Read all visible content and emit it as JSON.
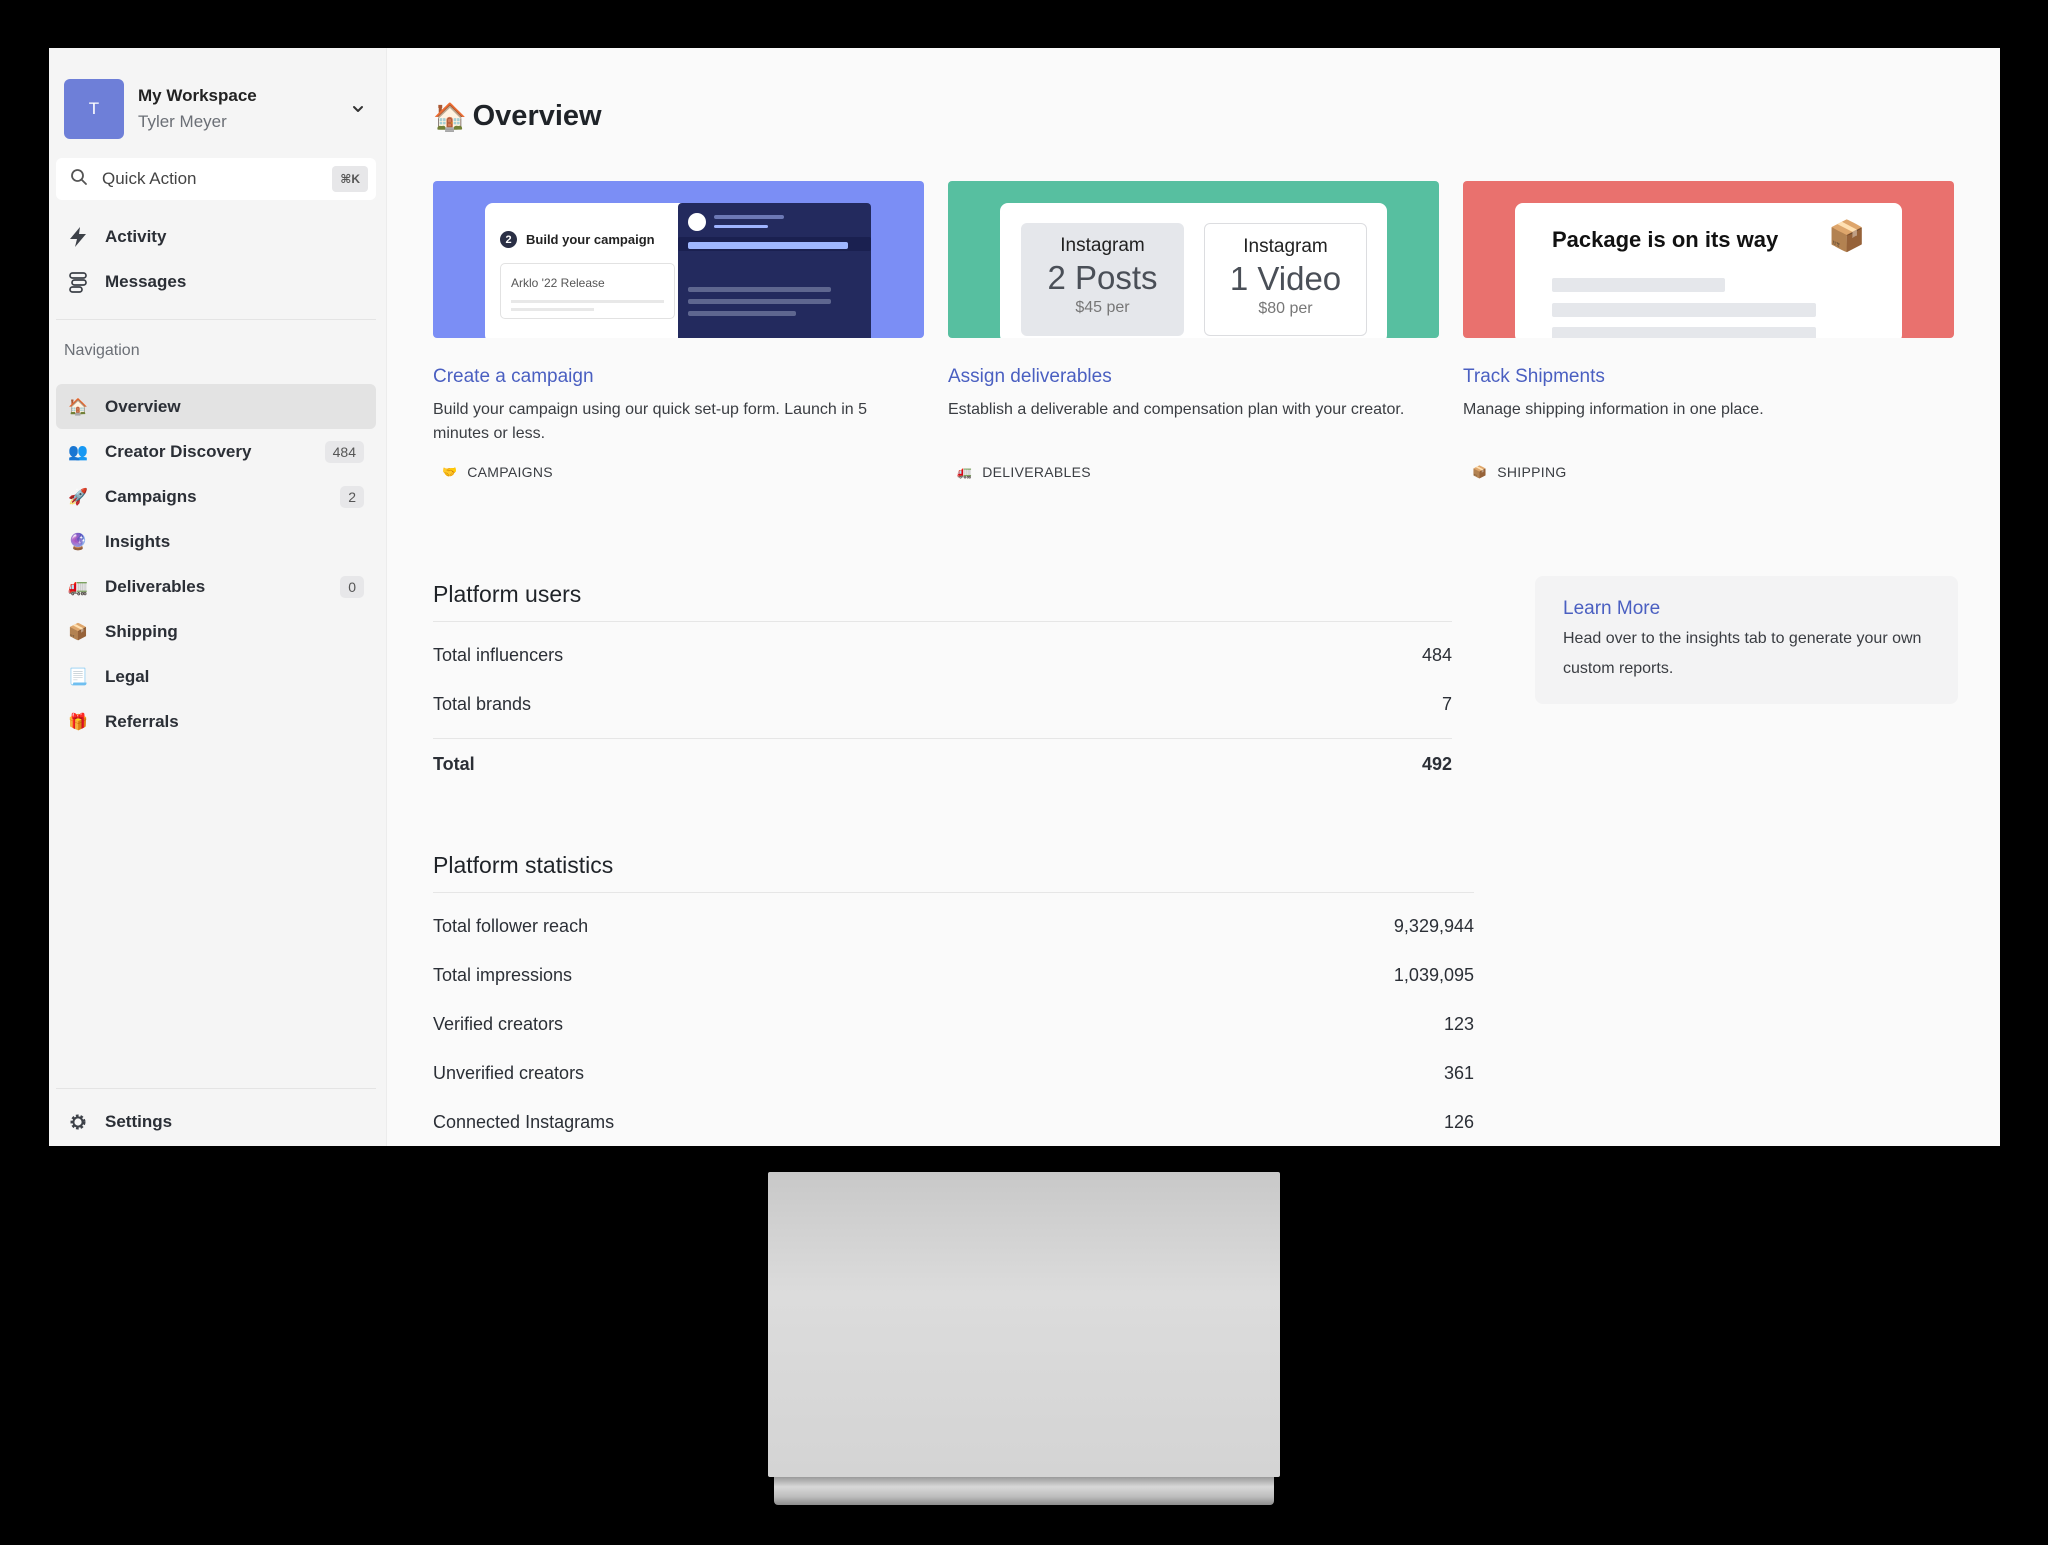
{
  "workspace": {
    "avatar_letter": "T",
    "name": "My Workspace",
    "user": "Tyler Meyer"
  },
  "quick_action": {
    "label": "Quick Action",
    "shortcut": "⌘K"
  },
  "top_nav": [
    {
      "label": "Activity",
      "icon": "bolt-icon"
    },
    {
      "label": "Messages",
      "icon": "messages-icon"
    }
  ],
  "navigation_label": "Navigation",
  "nav": [
    {
      "label": "Overview",
      "icon": "🏠",
      "active": true
    },
    {
      "label": "Creator Discovery",
      "icon": "👥",
      "badge": "484"
    },
    {
      "label": "Campaigns",
      "icon": "🚀",
      "badge": "2"
    },
    {
      "label": "Insights",
      "icon": "🔮"
    },
    {
      "label": "Deliverables",
      "icon": "🚛",
      "badge": "0"
    },
    {
      "label": "Shipping",
      "icon": "📦"
    },
    {
      "label": "Legal",
      "icon": "📃"
    },
    {
      "label": "Referrals",
      "icon": "🎁"
    }
  ],
  "settings_label": "Settings",
  "page": {
    "title_emoji": "🏠",
    "title": "Overview"
  },
  "cards": [
    {
      "title": "Create a campaign",
      "description": "Build your campaign using our quick set-up form. Launch in 5 minutes or less.",
      "tag_icon": "🤝",
      "tag": "CAMPAIGNS",
      "banner": {
        "step_number": "2",
        "step_label": "Build your campaign",
        "field_value": "Arklo '22 Release"
      }
    },
    {
      "title": "Assign deliverables",
      "description": "Establish a deliverable and compensation plan with your creator.",
      "tag_icon": "🚛",
      "tag": "DELIVERABLES",
      "banner": {
        "boxes": [
          {
            "platform": "Instagram",
            "amount": "2 Posts",
            "price": "$45 per"
          },
          {
            "platform": "Instagram",
            "amount": "1 Video",
            "price": "$80 per"
          }
        ]
      }
    },
    {
      "title": "Track Shipments",
      "description": "Manage shipping information in one place.",
      "tag_icon": "📦",
      "tag": "SHIPPING",
      "banner": {
        "headline": "Package is on its way",
        "emoji": "📦"
      }
    }
  ],
  "platform_users": {
    "title": "Platform users",
    "rows": [
      {
        "label": "Total influencers",
        "value": "484"
      },
      {
        "label": "Total brands",
        "value": "7"
      }
    ],
    "total": {
      "label": "Total",
      "value": "492"
    }
  },
  "platform_statistics": {
    "title": "Platform statistics",
    "rows": [
      {
        "label": "Total follower reach",
        "value": "9,329,944"
      },
      {
        "label": "Total impressions",
        "value": "1,039,095"
      },
      {
        "label": "Verified creators",
        "value": "123"
      },
      {
        "label": "Unverified creators",
        "value": "361"
      },
      {
        "label": "Connected Instagrams",
        "value": "126"
      }
    ]
  },
  "learn_more": {
    "title": "Learn More",
    "text": "Head over to the insights tab to generate your own custom reports."
  },
  "colors": {
    "accent": "#4a5fc1",
    "avatar": "#6e7fd8",
    "banner_campaign": "#7b8ef5",
    "banner_deliverables": "#57bfa0",
    "banner_shipping": "#e9716e"
  }
}
